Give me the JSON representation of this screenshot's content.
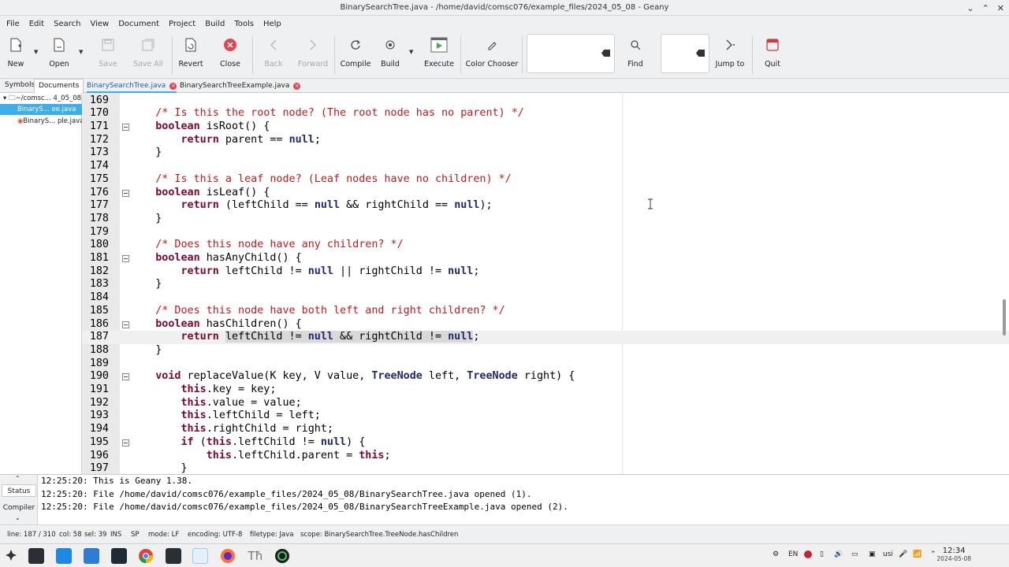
{
  "window": {
    "title": "BinarySearchTree.java - /home/david/comsc076/example_files/2024_05_08 - Geany"
  },
  "menu": [
    "File",
    "Edit",
    "Search",
    "View",
    "Document",
    "Project",
    "Build",
    "Tools",
    "Help"
  ],
  "toolbar": {
    "new": "New",
    "open": "Open",
    "save": "Save",
    "save_all": "Save All",
    "revert": "Revert",
    "close": "Close",
    "back": "Back",
    "forward": "Forward",
    "compile": "Compile",
    "build": "Build",
    "execute": "Execute",
    "color_chooser": "Color Chooser",
    "find": "Find",
    "jump_to": "Jump to",
    "quit": "Quit"
  },
  "sidebar": {
    "tabs": [
      "Symbols",
      "Documents"
    ],
    "folder": "~/comsc... 4_05_08",
    "files": [
      "BinaryS... ee.java",
      "BinaryS... ple.java"
    ]
  },
  "doc_tabs": [
    "BinarySearchTree.java",
    "BinarySearchTreeExample.java"
  ],
  "editor": {
    "lines": [
      {
        "n": "169",
        "tokens": []
      },
      {
        "n": "170",
        "tokens": [
          [
            "    ",
            ""
          ],
          [
            "/* Is this the root node? (The root node has no parent) */",
            "cm"
          ]
        ]
      },
      {
        "n": "171",
        "fold": true,
        "tokens": [
          [
            "    ",
            ""
          ],
          [
            "boolean",
            "kw"
          ],
          [
            " isRoot() {",
            ""
          ]
        ]
      },
      {
        "n": "172",
        "tokens": [
          [
            "        ",
            ""
          ],
          [
            "return",
            "kw"
          ],
          [
            " parent == ",
            ""
          ],
          [
            "null",
            "nu"
          ],
          [
            ";",
            ""
          ]
        ]
      },
      {
        "n": "173",
        "tokens": [
          [
            "    }",
            ""
          ]
        ]
      },
      {
        "n": "174",
        "tokens": []
      },
      {
        "n": "175",
        "tokens": [
          [
            "    ",
            ""
          ],
          [
            "/* Is this a leaf node? (Leaf nodes have no children) */",
            "cm"
          ]
        ]
      },
      {
        "n": "176",
        "fold": true,
        "tokens": [
          [
            "    ",
            ""
          ],
          [
            "boolean",
            "kw"
          ],
          [
            " isLeaf() {",
            ""
          ]
        ]
      },
      {
        "n": "177",
        "tokens": [
          [
            "        ",
            ""
          ],
          [
            "return",
            "kw"
          ],
          [
            " (leftChild == ",
            ""
          ],
          [
            "null",
            "nu"
          ],
          [
            " && rightChild == ",
            ""
          ],
          [
            "null",
            "nu"
          ],
          [
            ");",
            ""
          ]
        ]
      },
      {
        "n": "178",
        "tokens": [
          [
            "    }",
            ""
          ]
        ]
      },
      {
        "n": "179",
        "tokens": []
      },
      {
        "n": "180",
        "tokens": [
          [
            "    ",
            ""
          ],
          [
            "/* Does this node have any children? */",
            "cm"
          ]
        ]
      },
      {
        "n": "181",
        "fold": true,
        "tokens": [
          [
            "    ",
            ""
          ],
          [
            "boolean",
            "kw"
          ],
          [
            " hasAnyChild() {",
            ""
          ]
        ]
      },
      {
        "n": "182",
        "tokens": [
          [
            "        ",
            ""
          ],
          [
            "return",
            "kw"
          ],
          [
            " leftChild != ",
            ""
          ],
          [
            "null",
            "nu"
          ],
          [
            " || rightChild != ",
            ""
          ],
          [
            "null",
            "nu"
          ],
          [
            ";",
            ""
          ]
        ]
      },
      {
        "n": "183",
        "tokens": [
          [
            "    }",
            ""
          ]
        ]
      },
      {
        "n": "184",
        "tokens": []
      },
      {
        "n": "185",
        "tokens": [
          [
            "    ",
            ""
          ],
          [
            "/* Does this node have both left and right children? */",
            "cm"
          ]
        ]
      },
      {
        "n": "186",
        "fold": true,
        "tokens": [
          [
            "    ",
            ""
          ],
          [
            "boolean",
            "kw"
          ],
          [
            " hasChildren() {",
            ""
          ]
        ]
      },
      {
        "n": "187",
        "current": true,
        "tokens": [
          [
            "        ",
            ""
          ],
          [
            "return",
            "kw"
          ],
          [
            " ",
            ""
          ],
          [
            "leftChild != ",
            "sel"
          ],
          [
            "null",
            "nu sel"
          ],
          [
            " && rightChild != ",
            "sel"
          ],
          [
            "null",
            "nu sel"
          ],
          [
            ";",
            ""
          ]
        ]
      },
      {
        "n": "188",
        "tokens": [
          [
            "    }",
            ""
          ]
        ]
      },
      {
        "n": "189",
        "tokens": []
      },
      {
        "n": "190",
        "fold": true,
        "tokens": [
          [
            "    ",
            ""
          ],
          [
            "void",
            "kw"
          ],
          [
            " replaceValue(K key, V value, ",
            ""
          ],
          [
            "TreeNode",
            "ty"
          ],
          [
            " left, ",
            ""
          ],
          [
            "TreeNode",
            "ty"
          ],
          [
            " right) {",
            ""
          ]
        ]
      },
      {
        "n": "191",
        "tokens": [
          [
            "        ",
            ""
          ],
          [
            "this",
            "kw"
          ],
          [
            ".key = key;",
            ""
          ]
        ]
      },
      {
        "n": "192",
        "tokens": [
          [
            "        ",
            ""
          ],
          [
            "this",
            "kw"
          ],
          [
            ".value = value;",
            ""
          ]
        ]
      },
      {
        "n": "193",
        "tokens": [
          [
            "        ",
            ""
          ],
          [
            "this",
            "kw"
          ],
          [
            ".leftChild = left;",
            ""
          ]
        ]
      },
      {
        "n": "194",
        "tokens": [
          [
            "        ",
            ""
          ],
          [
            "this",
            "kw"
          ],
          [
            ".rightChild = right;",
            ""
          ]
        ]
      },
      {
        "n": "195",
        "fold": true,
        "tokens": [
          [
            "        ",
            ""
          ],
          [
            "if",
            "kw"
          ],
          [
            " (",
            ""
          ],
          [
            "this",
            "kw"
          ],
          [
            ".leftChild != ",
            ""
          ],
          [
            "null",
            "nu"
          ],
          [
            ") {",
            ""
          ]
        ]
      },
      {
        "n": "196",
        "tokens": [
          [
            "            ",
            ""
          ],
          [
            "this",
            "kw"
          ],
          [
            ".leftChild.parent = ",
            ""
          ],
          [
            "this",
            "kw"
          ],
          [
            ";",
            ""
          ]
        ]
      },
      {
        "n": "197",
        "tokens": [
          [
            "        }",
            ""
          ]
        ]
      }
    ]
  },
  "messages": {
    "tabs": [
      "Status",
      "Compiler"
    ],
    "lines": [
      "12:25:20: This is Geany 1.38.",
      "12:25:20: File /home/david/comsc076/example_files/2024_05_08/BinarySearchTree.java opened (1).",
      "12:25:20: File /home/david/comsc076/example_files/2024_05_08/BinarySearchTreeExample.java opened (2)."
    ]
  },
  "status": {
    "line": "line: 187 / 310",
    "col": "col: 58",
    "sel": "sel: 39",
    "ins": "INS",
    "sp": "SP",
    "mode": "mode: LF",
    "encoding": "encoding: UTF-8",
    "filetype": "filetype: Java",
    "scope": "scope: BinarySearchTree.TreeNode.hasChildren"
  },
  "taskbar": {
    "lang": "EN",
    "kb_layout": "usi",
    "time": "12:34",
    "date": "2024-05-08"
  },
  "colors": {
    "accent": "#3daee9",
    "close_red": "#e0464b",
    "execute_green": "#3fae49"
  }
}
